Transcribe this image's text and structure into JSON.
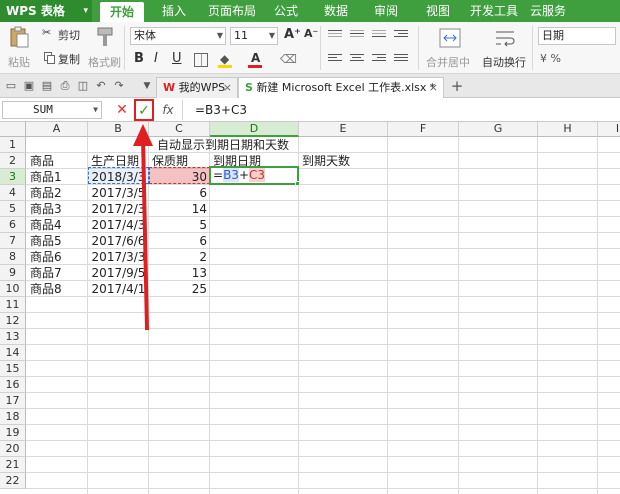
{
  "app": {
    "logo": "WPS 表格",
    "dropdown_glyph": "▾"
  },
  "menu": {
    "tabs": [
      "开始",
      "插入",
      "页面布局",
      "公式",
      "数据",
      "审阅",
      "视图",
      "开发工具",
      "云服务"
    ],
    "active_tab": "开始"
  },
  "ribbon": {
    "paste_label": "粘贴",
    "cut_label": "剪切",
    "copy_label": "复制",
    "format_painter_label": "格式刷",
    "font_name": "宋体",
    "font_size": "11",
    "bold": "B",
    "italic": "I",
    "underline": "U",
    "font_grow": "A⁺",
    "font_shrink": "A⁻",
    "merge_label": "合并居中",
    "wrap_label": "自动换行",
    "number_format": "日期"
  },
  "tabs_bar": {
    "home_tab": "我的WPS",
    "doc_tab": "新建 Microsoft Excel 工作表.xlsx *",
    "close_glyph": "×",
    "add_glyph": "+"
  },
  "formula_bar": {
    "name_box": "SUM",
    "cancel_glyph": "✕",
    "enter_glyph": "✓",
    "fx_label": "fx",
    "formula": "=B3+C3"
  },
  "sheet": {
    "columns": [
      "A",
      "B",
      "C",
      "D",
      "E",
      "F",
      "G",
      "H",
      "I"
    ],
    "selected_column": "D",
    "rows": [
      "1",
      "2",
      "3",
      "4",
      "5",
      "6",
      "7",
      "8",
      "9",
      "10",
      "11",
      "12",
      "13",
      "14",
      "15",
      "16",
      "17",
      "18",
      "19",
      "20",
      "21",
      "22"
    ],
    "selected_row": "3",
    "title": "自动显示到期日期和天数",
    "headers": {
      "a": "商品",
      "b": "生产日期",
      "c": "保质期",
      "d": "到期日期",
      "e": "到期天数"
    },
    "data_rows": [
      {
        "a": "商品1",
        "b": "2018/3/3",
        "c": "30"
      },
      {
        "a": "商品2",
        "b": "2017/3/5",
        "c": "6"
      },
      {
        "a": "商品3",
        "b": "2017/2/3",
        "c": "14"
      },
      {
        "a": "商品4",
        "b": "2017/4/3",
        "c": "5"
      },
      {
        "a": "商品5",
        "b": "2017/6/6",
        "c": "6"
      },
      {
        "a": "商品6",
        "b": "2017/3/3",
        "c": "2"
      },
      {
        "a": "商品7",
        "b": "2017/9/5",
        "c": "13"
      },
      {
        "a": "商品8",
        "b": "2017/4/1",
        "c": "25"
      }
    ],
    "edit_cell": {
      "prefix": "=",
      "ref1": "B3",
      "op": "+",
      "ref2": "C3"
    }
  },
  "colors": {
    "accent": "#3f9f3f",
    "annotation": "#e02020"
  }
}
